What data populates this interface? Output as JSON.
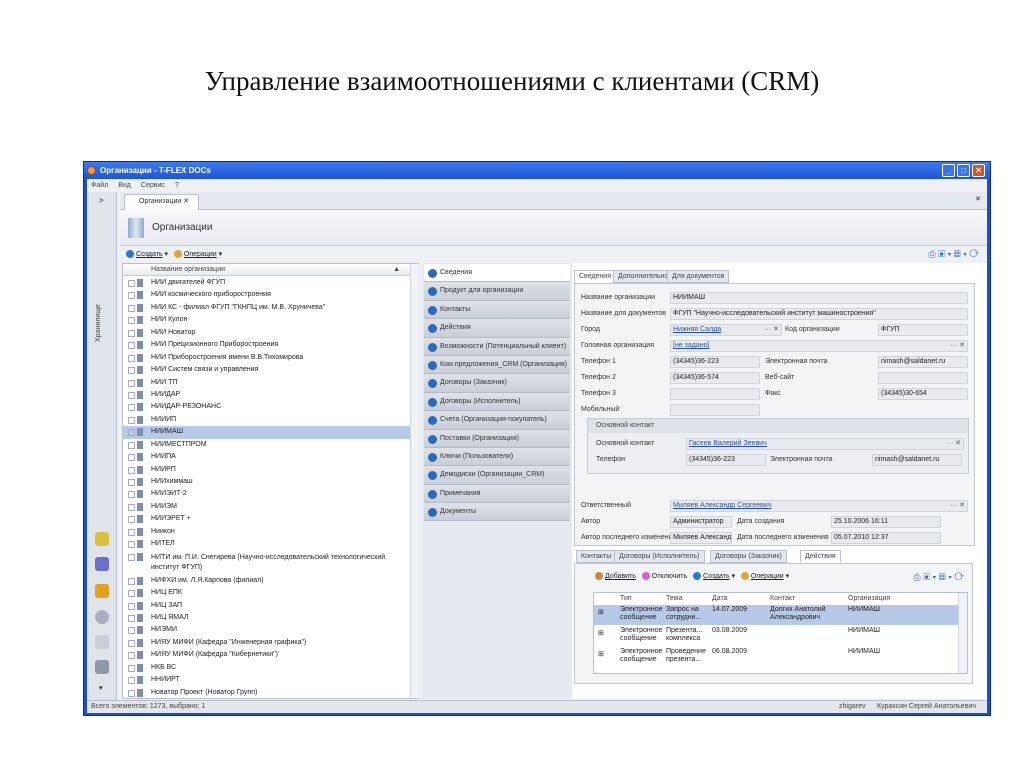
{
  "slide_title": "Управление взаимоотношениями с клиентами (CRM)",
  "window": {
    "title": "Организации - T-FLEX DOCs",
    "minimize": "_",
    "maximize": "□",
    "close": "✕"
  },
  "menu": [
    "Файл",
    "Вид",
    "Сервис",
    "?"
  ],
  "left_pane": {
    "expand": ">",
    "label": "Хранилище",
    "more": "▾"
  },
  "doc_tab": {
    "label": "Организации",
    "close": "✕"
  },
  "header": {
    "title": "Организации"
  },
  "toolbar": {
    "create": "Создать",
    "operations": "Операции",
    "icons": "⎙ ▣ ▾ ▦ ▾ ⟳"
  },
  "list": {
    "column": "Название организации",
    "sort": "▲",
    "rows": [
      "НИИ двигателей ФГУП",
      "НИИ космического приборостроения",
      "НИИ КС - филиал ФГУП \"ГКНПЦ им. М.В. Хруничева\"",
      "НИИ Кулон",
      "НИИ Новатор",
      "НИИ Прецизионного Приборостроения",
      "НИИ Приборостроения имени В.В.Тихомирова",
      "НИИ Систем связи и управления",
      "НИИ ТП",
      "НИИДАР",
      "НИИДАР-РЕЗОНАНС",
      "НИИИП",
      "НИИМАШ",
      "НИИМЕСТПРОМ",
      "НИИПА",
      "НИИРП",
      "НИИхиммаш",
      "НИИЭИТ-2",
      "НИИЭМ",
      "НИИЭРЕТ +",
      "Ниикон",
      "НИТЕЛ",
      "НИТИ им. П.И. Снегирева (Научно-исследовательский технологический институт ФГУП)",
      "НИФХИ им. Л.Я.Карпова (филиал)",
      "НИЦ ЕПК",
      "НИЦ ЗАП",
      "НИЦ ЯМАЛ",
      "НИЭМИ",
      "НИЯУ МИФИ (Кафедра \"Инженерная графика\")",
      "НИЯУ МИФИ (Кафедра \"Кибернетики\")",
      "НКБ ВС",
      "ННИИРТ",
      "Новатор Проект (Новатор Групп)"
    ],
    "selected_index": 12
  },
  "nav": [
    "Сведения",
    "Продукт для организации",
    "Контакты",
    "Действия",
    "Возможности (Потенциальный клиент)",
    "Ком.предложения_CRM (Организация)",
    "Договоры (Заказчик)",
    "Договоры (Исполнитель)",
    "Счета (Организация-покупатель)",
    "Поставки (Организация)",
    "Ключи (Пользователи)",
    "Демодиски (Организации_CRM)",
    "Примечания",
    "Документы"
  ],
  "form": {
    "tabs": [
      "Сведения",
      "Дополнительно",
      "Для документов"
    ],
    "labels": {
      "name": "Название организации",
      "doc_name": "Название для документов",
      "city": "Город",
      "code": "Код организации",
      "parent": "Головная организация",
      "phone1": "Телефон 1",
      "phone2": "Телефон 2",
      "phone3": "Телефон 3",
      "mobile": "Мобильный",
      "email": "Электронная почта",
      "web": "Веб-сайт",
      "fax": "Факс",
      "responsible": "Ответственный",
      "author": "Автор",
      "created": "Дата создания",
      "last_author": "Автор последнего изменения",
      "modified": "Дата последнего изменения"
    },
    "values": {
      "name": "НИИМАШ",
      "doc_name": "ФГУП \"Научно-исследовательский институт машиностроения\"",
      "city": "Нижняя Салда",
      "code": "ФГУП",
      "parent": "[не задано]",
      "phone1": "(34345)36-223",
      "phone2": "(34345)36-574",
      "phone3": "",
      "mobile": "",
      "email": "nimash@saldanet.ru",
      "web": "",
      "fax": "(34345)30-654",
      "responsible": "Миляев Александр Сергеевич",
      "author": "Администратор",
      "created": "25.10.2006 16:11",
      "last_author": "Миляев Александр",
      "modified": "05.07.2010 12:37"
    },
    "contact_group": {
      "title": "Основной контакт",
      "contact_label": "Основной контакт",
      "contact": "Гасеев Валерий Зеевич",
      "phone_label": "Телефон",
      "phone": "(34345)36-223",
      "email_label": "Электронная почта",
      "email": "nimash@saldanet.ru"
    }
  },
  "bottom": {
    "tabs": [
      "Контакты",
      "Договоры (Исполнитель)",
      "Договоры (Заказчик)",
      "Действия"
    ],
    "toolbar": {
      "add": "Добавить",
      "detach": "Отключить",
      "create": "Создать",
      "operations": "Операции"
    },
    "columns": [
      "Тип",
      "Тема",
      "Дата",
      "Контакт",
      "Организация"
    ],
    "rows": [
      {
        "type": "Электронное сообщение",
        "topic": "Запрос на сотрудни...",
        "date": "14.07.2009",
        "contact": "Долгих Анатолий Александрович",
        "org": "НИИМАШ"
      },
      {
        "type": "Электронное сообщение",
        "topic": "Презента... комплекса",
        "date": "03.08.2009",
        "contact": "",
        "org": "НИИМАШ"
      },
      {
        "type": "Электронное сообщение",
        "topic": "Проведение презента...",
        "date": "06.08.2009",
        "contact": "",
        "org": "НИИМАШ"
      }
    ]
  },
  "status": {
    "left": "Всего элементов: 1273, выбрано: 1",
    "user": "zhigarev",
    "name": "Курахсин Сергей Анатольевич"
  }
}
